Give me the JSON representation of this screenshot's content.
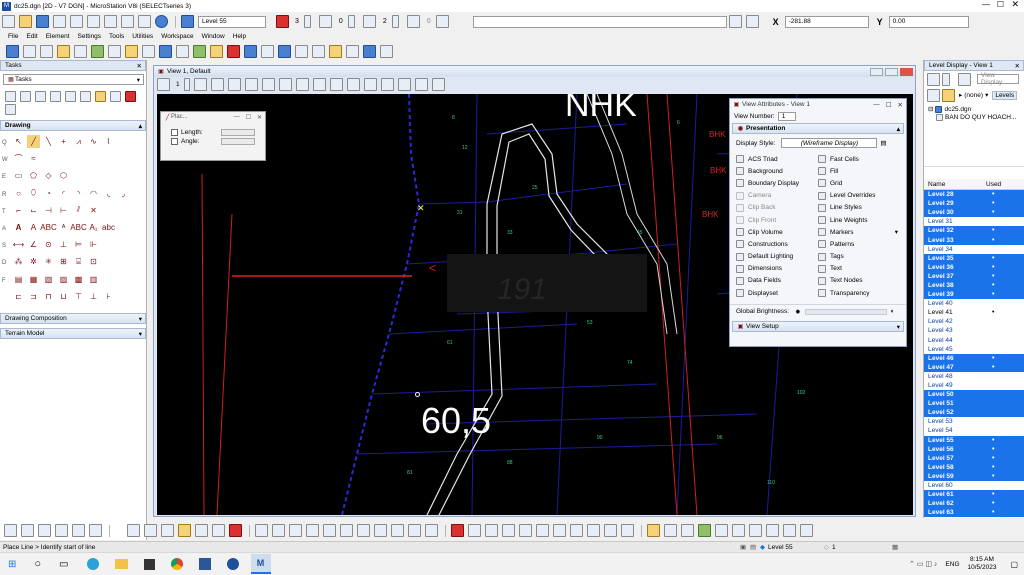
{
  "window": {
    "title": "dc25.dgn [2D - V7 DGN] - MicroStation V8i (SELECTseries 3)",
    "active_level": "Level 55",
    "color_value": "3",
    "line_style_value": "0",
    "weight_value": "2",
    "transparency_value": "0",
    "x_label": "X",
    "x_value": "-281.88",
    "y_label": "Y",
    "y_value": "0.00"
  },
  "menu": [
    "File",
    "Edit",
    "Element",
    "Settings",
    "Tools",
    "Utilities",
    "Workspace",
    "Window",
    "Help"
  ],
  "tasks": {
    "title": "Tasks",
    "dropdown": "Tasks",
    "drawing_label": "Drawing",
    "row_letters": [
      "Q",
      "W",
      "E",
      "R",
      "T",
      "A",
      "S",
      "D",
      "F"
    ],
    "drawing_composition": "Drawing Composition",
    "terrain_model": "Terrain Model"
  },
  "view": {
    "title": "View 1, Default",
    "view_number": "1",
    "texts": {
      "nhk": "NHK",
      "big_number": "60,5",
      "bhk1": "BHK",
      "bhk2": "BHK",
      "bhk3": "BHK"
    }
  },
  "place_dialog": {
    "title": "Plac...",
    "length_label": "Length:",
    "angle_label": "Angle:"
  },
  "view_attributes": {
    "title": "View Attributes - View 1",
    "view_number_label": "View Number:",
    "view_number_value": "1",
    "section": "Presentation",
    "display_style_label": "Display Style:",
    "display_style_value": "(Wireframe Display)",
    "left_items": [
      {
        "label": "ACS Triad",
        "dim": false
      },
      {
        "label": "Background",
        "dim": false
      },
      {
        "label": "Boundary Display",
        "dim": false
      },
      {
        "label": "Camera",
        "dim": true
      },
      {
        "label": "Clip Back",
        "dim": true
      },
      {
        "label": "Clip Front",
        "dim": true
      },
      {
        "label": "Clip Volume",
        "dim": false
      },
      {
        "label": "Constructions",
        "dim": false
      },
      {
        "label": "Default Lighting",
        "dim": false
      },
      {
        "label": "Dimensions",
        "dim": false
      },
      {
        "label": "Data Fields",
        "dim": false
      },
      {
        "label": "Displayset",
        "dim": false
      }
    ],
    "right_items": [
      {
        "label": "Fast Cells",
        "dim": false
      },
      {
        "label": "Fill",
        "dim": false
      },
      {
        "label": "Grid",
        "dim": false
      },
      {
        "label": "Level Overrides",
        "dim": false
      },
      {
        "label": "Line Styles",
        "dim": false
      },
      {
        "label": "Line Weights",
        "dim": false
      },
      {
        "label": "Markers",
        "dim": false
      },
      {
        "label": "Patterns",
        "dim": false
      },
      {
        "label": "Tags",
        "dim": false
      },
      {
        "label": "Text",
        "dim": false
      },
      {
        "label": "Text Nodes",
        "dim": false
      },
      {
        "label": "Transparency",
        "dim": false
      }
    ],
    "global_brightness_label": "Global Brightness:",
    "view_setup": "View Setup"
  },
  "level_display": {
    "title": "Level Display - View 1",
    "view_display": "View Display",
    "filter": "(none)",
    "levels_button": "Levels",
    "tree_file": "dc25.dgn",
    "tree_model": "BAN DO QUY HOACH...",
    "col_name": "Name",
    "col_used": "Used",
    "levels": [
      {
        "name": "Level 28",
        "state": "sel",
        "used": true
      },
      {
        "name": "Level 29",
        "state": "sel",
        "used": true
      },
      {
        "name": "Level 30",
        "state": "sel",
        "used": true
      },
      {
        "name": "Level 31",
        "state": "un",
        "used": false
      },
      {
        "name": "Level 32",
        "state": "sel",
        "used": true
      },
      {
        "name": "Level 33",
        "state": "sel",
        "used": true
      },
      {
        "name": "Level 34",
        "state": "un",
        "used": false
      },
      {
        "name": "Level 35",
        "state": "sel",
        "used": true
      },
      {
        "name": "Level 36",
        "state": "sel",
        "used": true
      },
      {
        "name": "Level 37",
        "state": "sel",
        "used": true
      },
      {
        "name": "Level 38",
        "state": "sel",
        "used": true
      },
      {
        "name": "Level 39",
        "state": "sel",
        "used": true
      },
      {
        "name": "Level 40",
        "state": "un",
        "used": false
      },
      {
        "name": "Level 41",
        "state": "white",
        "used": true
      },
      {
        "name": "Level 42",
        "state": "un",
        "used": false
      },
      {
        "name": "Level 43",
        "state": "un",
        "used": false
      },
      {
        "name": "Level 44",
        "state": "un",
        "used": false
      },
      {
        "name": "Level 45",
        "state": "un",
        "used": false
      },
      {
        "name": "Level 46",
        "state": "sel",
        "used": true
      },
      {
        "name": "Level 47",
        "state": "sel",
        "used": true
      },
      {
        "name": "Level 48",
        "state": "un",
        "used": false
      },
      {
        "name": "Level 49",
        "state": "un",
        "used": false
      },
      {
        "name": "Level 50",
        "state": "sel",
        "used": false
      },
      {
        "name": "Level 51",
        "state": "sel",
        "used": false
      },
      {
        "name": "Level 52",
        "state": "sel",
        "used": false
      },
      {
        "name": "Level 53",
        "state": "un",
        "used": false
      },
      {
        "name": "Level 54",
        "state": "un",
        "used": false
      },
      {
        "name": "Level 55",
        "state": "sel",
        "used": true
      },
      {
        "name": "Level 56",
        "state": "sel",
        "used": true
      },
      {
        "name": "Level 57",
        "state": "sel",
        "used": true
      },
      {
        "name": "Level 58",
        "state": "sel",
        "used": true
      },
      {
        "name": "Level 59",
        "state": "sel",
        "used": true
      },
      {
        "name": "Level 60",
        "state": "un",
        "used": false
      },
      {
        "name": "Level 61",
        "state": "sel",
        "used": true
      },
      {
        "name": "Level 62",
        "state": "sel",
        "used": true
      },
      {
        "name": "Level 63",
        "state": "sel",
        "used": true
      }
    ]
  },
  "status": {
    "prompt": "Place Line > Identify start of line",
    "level": "Level 55",
    "scale": "1"
  },
  "taskbar": {
    "time": "8:15 AM",
    "date": "10/5/2023",
    "lang": "ENG"
  },
  "colors": {
    "selection": "#1a73e8",
    "canvas": "#000000",
    "parcel_blue": "#2a2ad8",
    "road_red": "#e02020"
  }
}
